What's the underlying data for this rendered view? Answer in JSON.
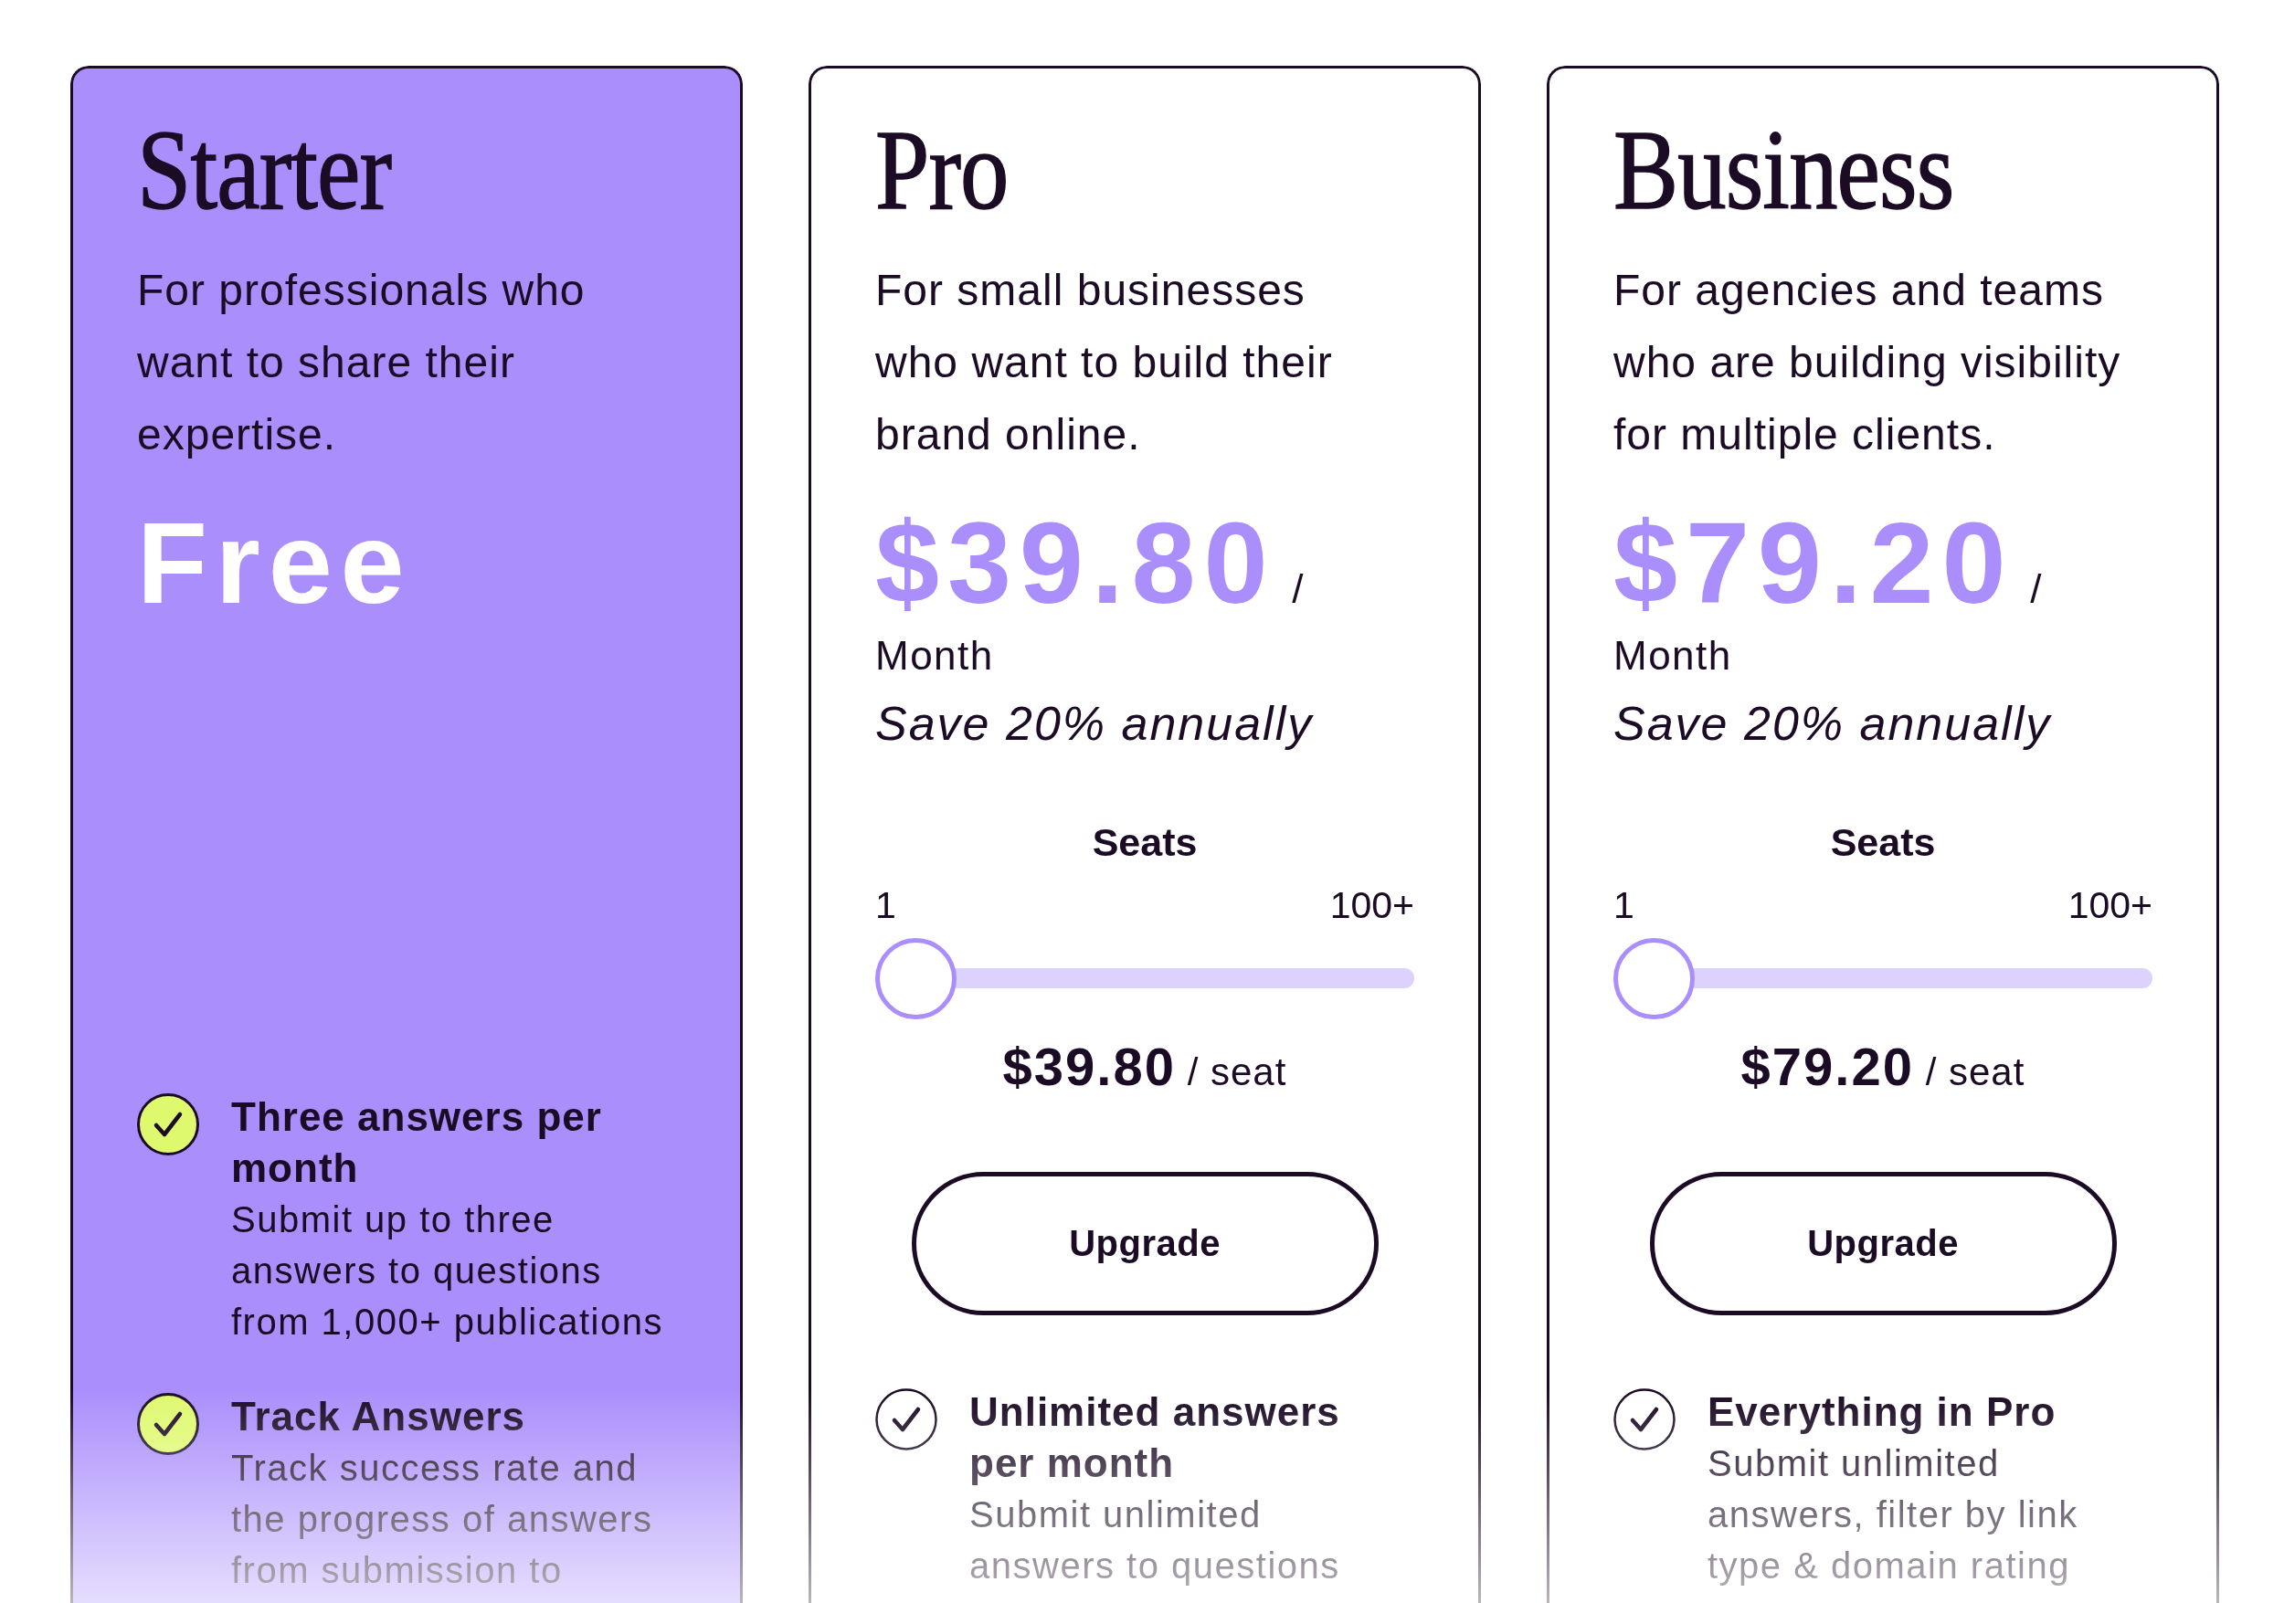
{
  "plans": [
    {
      "name": "Starter",
      "highlighted": true,
      "description": "For professionals who want to share their expertise.",
      "price": {
        "amount": "Free"
      },
      "features": [
        {
          "title": "Three answers per month",
          "description": "Submit up to three answers to questions from 1,000+ publications"
        },
        {
          "title": "Track Answers",
          "description": "Track success rate and the progress of answers from submission to"
        }
      ]
    },
    {
      "name": "Pro",
      "highlighted": false,
      "description": "For small businesses who want to build their brand online.",
      "price": {
        "amount": "$39.80",
        "separator": "/",
        "period": "Month",
        "note": "Save 20% annually"
      },
      "seats": {
        "label": "Seats",
        "min_label": "1",
        "max_label": "100+",
        "level": 0,
        "per_seat": "**$39.80** / seat"
      },
      "button": "Upgrade",
      "features": [
        {
          "title": "Unlimited answers per month",
          "description": "Submit unlimited answers to questions"
        }
      ]
    },
    {
      "name": "Business",
      "highlighted": false,
      "description": "For agencies and teams who are building visibility for multiple clients.",
      "price": {
        "amount": "$79.20",
        "separator": "/",
        "period": "Month",
        "note": "Save 20% annually"
      },
      "seats": {
        "label": "Seats",
        "min_label": "1",
        "max_label": "100+",
        "level": 0,
        "per_seat": "**$79.20** / seat"
      },
      "button": "Upgrade",
      "features": [
        {
          "title": "Everything in Pro",
          "description": "Submit unlimited answers, filter by link type & domain rating"
        }
      ]
    }
  ]
}
